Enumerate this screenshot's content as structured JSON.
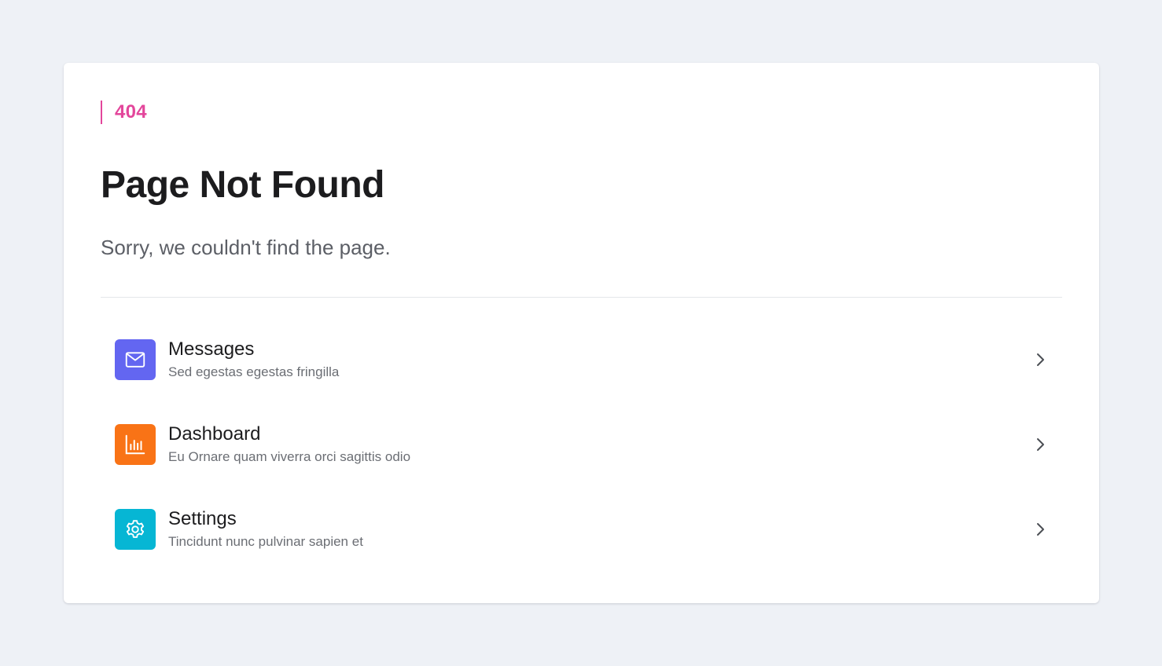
{
  "error": {
    "code": "404",
    "accent_color": "#e3469b"
  },
  "page": {
    "title": "Page Not Found",
    "subtitle": "Sorry, we couldn't find the page."
  },
  "links": [
    {
      "title": "Messages",
      "description": "Sed egestas egestas fringilla",
      "icon": "envelope-icon",
      "color": "#6366f1"
    },
    {
      "title": "Dashboard",
      "description": "Eu Ornare quam viverra orci sagittis odio",
      "icon": "bar-chart-icon",
      "color": "#f97316"
    },
    {
      "title": "Settings",
      "description": "Tincidunt nunc pulvinar sapien et",
      "icon": "gear-icon",
      "color": "#06b6d4"
    }
  ]
}
